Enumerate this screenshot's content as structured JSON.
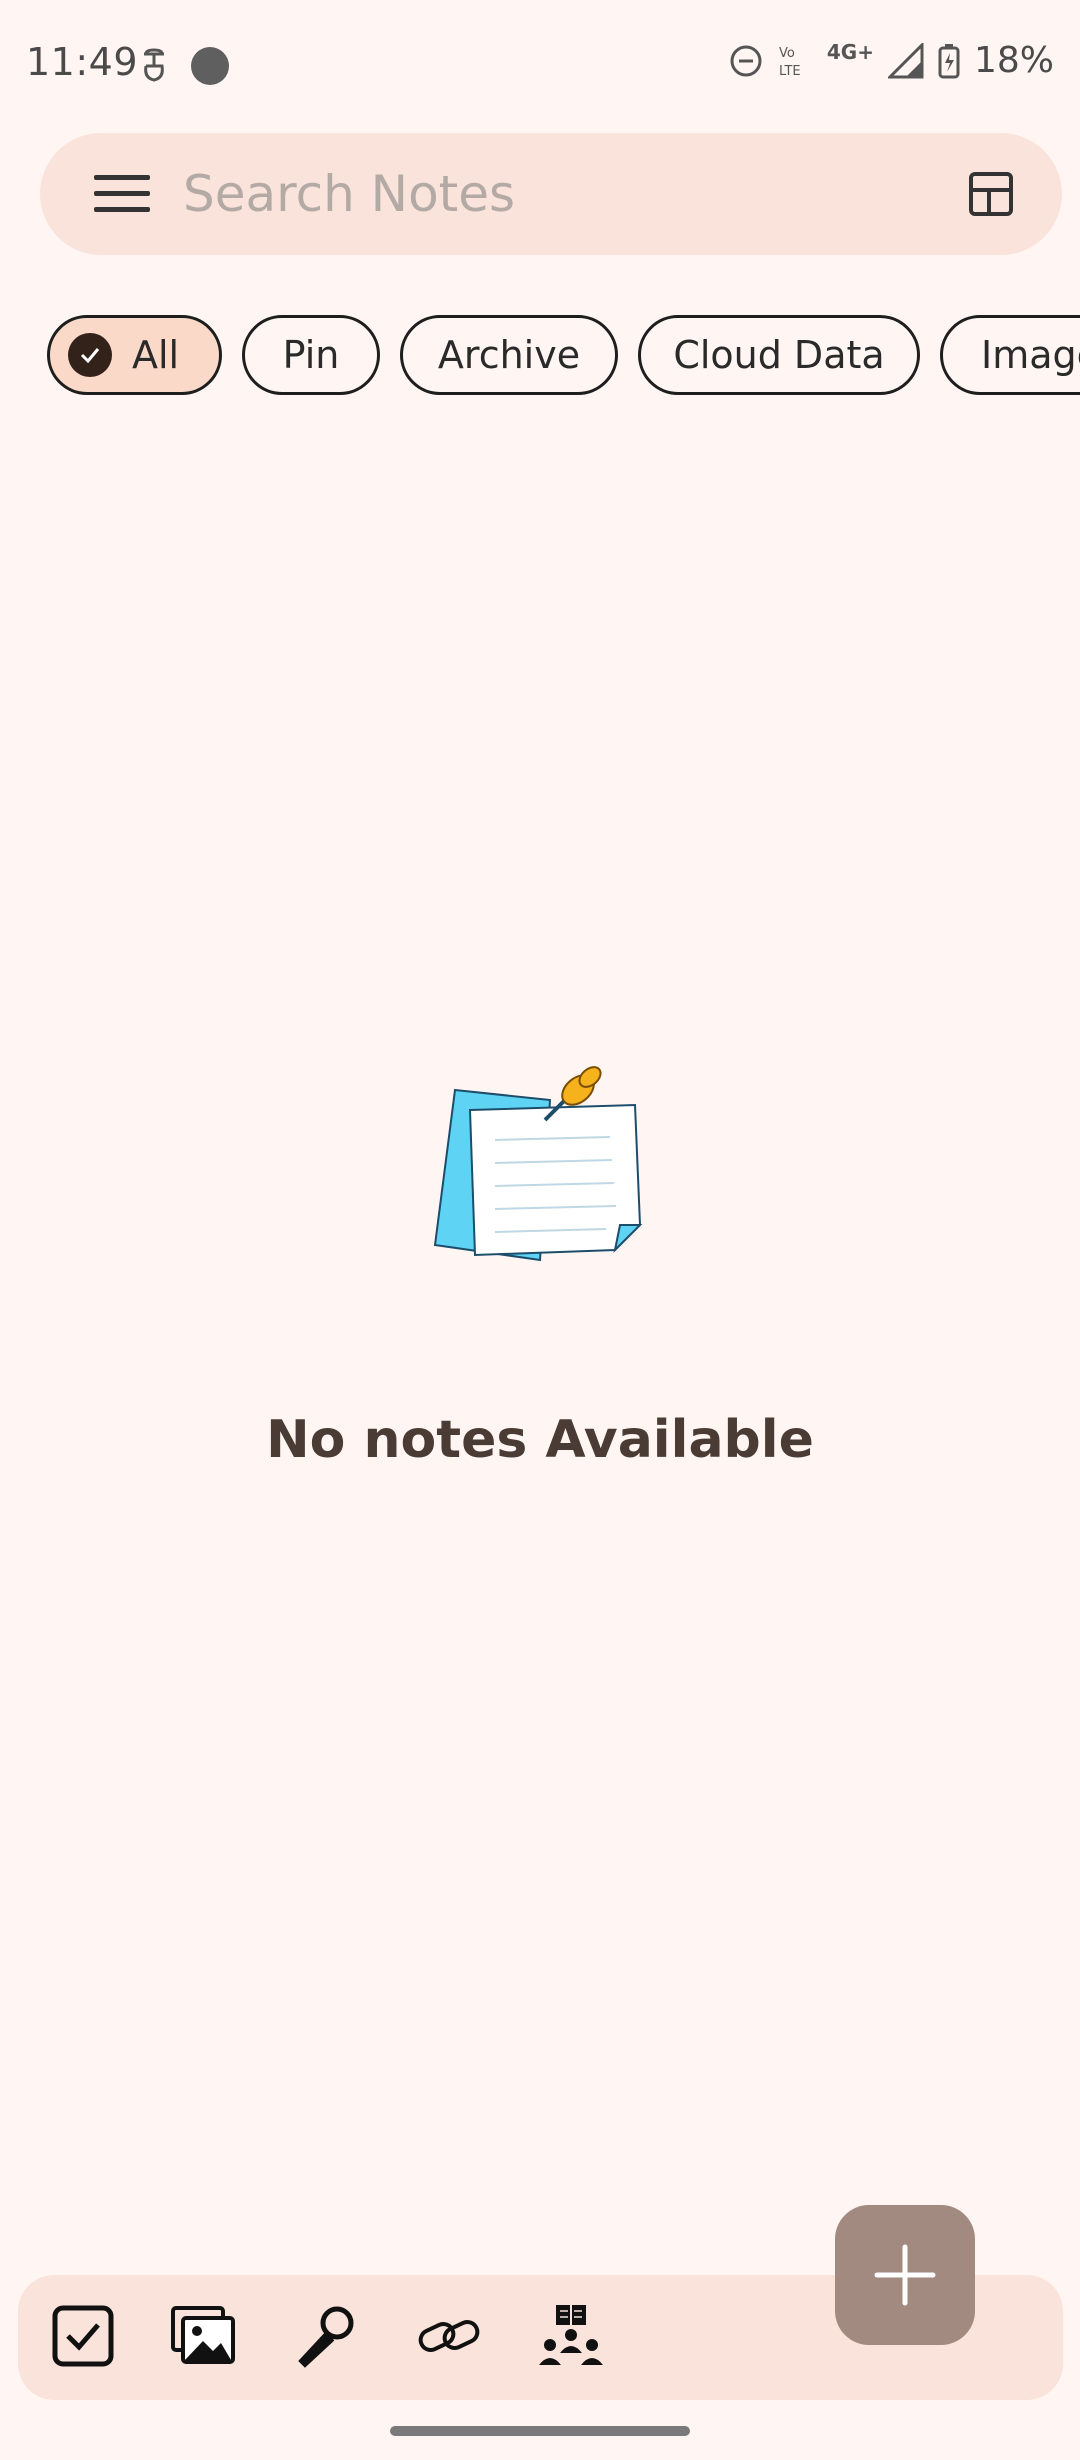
{
  "status_bar": {
    "time": "11:49",
    "battery": "18%",
    "network": "4G+",
    "volte": "Vo LTE"
  },
  "search": {
    "placeholder": "Search Notes"
  },
  "filters": [
    {
      "label": "All",
      "selected": true
    },
    {
      "label": "Pin",
      "selected": false
    },
    {
      "label": "Archive",
      "selected": false
    },
    {
      "label": "Cloud Data",
      "selected": false
    },
    {
      "label": "Images",
      "selected": false
    }
  ],
  "empty_state": {
    "message": "No notes Available"
  },
  "bottom_bar": {
    "items": [
      "checkbox-icon",
      "image-icon",
      "microphone-icon",
      "link-icon",
      "community-icon"
    ]
  },
  "colors": {
    "background": "#FFF6F3",
    "surface": "#FAE3DA",
    "chip_selected": "#FAD9C8",
    "fab": "#A38A80",
    "text_primary": "#4A3C34"
  }
}
